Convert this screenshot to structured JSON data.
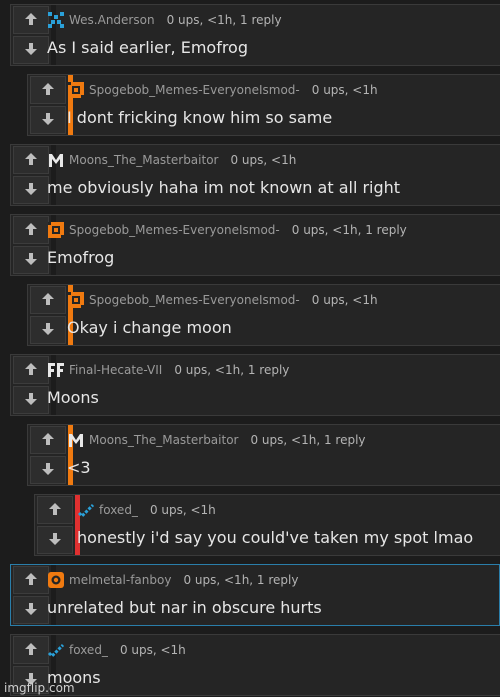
{
  "comments": [
    {
      "author": "Wes.Anderson",
      "stats": "0 ups, <1h, 1 reply",
      "text": "As I said earlier, Emofrog",
      "avatar": "pixel-blue-pattern-avatar",
      "bar_color": "#1c1c1c"
    },
    {
      "author": "Spogebob_Memes-EveryoneIsmod-",
      "stats": "0 ups, <1h",
      "text": "I dont fricking know him so same",
      "avatar": "orange-square-avatar",
      "bar_color": "#f07a10"
    },
    {
      "author": "Moons_The_Masterbaitor",
      "stats": "0 ups, <1h",
      "text": "me obviously haha im not known at all right",
      "avatar": "white-m-avatar",
      "bar_color": "#1c1c1c"
    },
    {
      "author": "Spogebob_Memes-EveryoneIsmod-",
      "stats": "0 ups, <1h, 1 reply",
      "text": "Emofrog",
      "avatar": "orange-square-avatar",
      "bar_color": "#1c1c1c"
    },
    {
      "author": "Spogebob_Memes-EveryoneIsmod-",
      "stats": "0 ups, <1h",
      "text": "Okay i change moon",
      "avatar": "orange-square-avatar",
      "bar_color": "#f07a10"
    },
    {
      "author": "Final-Hecate-VII",
      "stats": "0 ups, <1h, 1 reply",
      "text": "Moons",
      "avatar": "white-ff-avatar",
      "bar_color": "#1c1c1c"
    },
    {
      "author": "Moons_The_Masterbaitor",
      "stats": "0 ups, <1h, 1 reply",
      "text": "<3",
      "avatar": "white-m-avatar",
      "bar_color": "#f07a10"
    },
    {
      "author": "foxed_",
      "stats": "0 ups, <1h",
      "text": "honestly i'd say you could've taken my spot lmao",
      "avatar": "blue-check-avatar",
      "bar_color": "#e03030"
    },
    {
      "author": "melmetal-fanboy",
      "stats": "0 ups, <1h, 1 reply",
      "text": "unrelated but nar in obscure hurts",
      "avatar": "orange-ring-avatar",
      "bar_color": "#1c1c1c"
    },
    {
      "author": "foxed_",
      "stats": "0 ups, <1h",
      "text": "moons",
      "avatar": "blue-check-avatar",
      "bar_color": "#1c1c1c"
    }
  ],
  "icons": {
    "upvote": "up-arrow-icon",
    "downvote": "down-arrow-icon"
  },
  "colors": {
    "orange": "#f07a10",
    "red": "#e03030",
    "blue": "#2aa0d8",
    "active_outline": "#2a7eaa"
  },
  "watermark": "imgflip.com"
}
